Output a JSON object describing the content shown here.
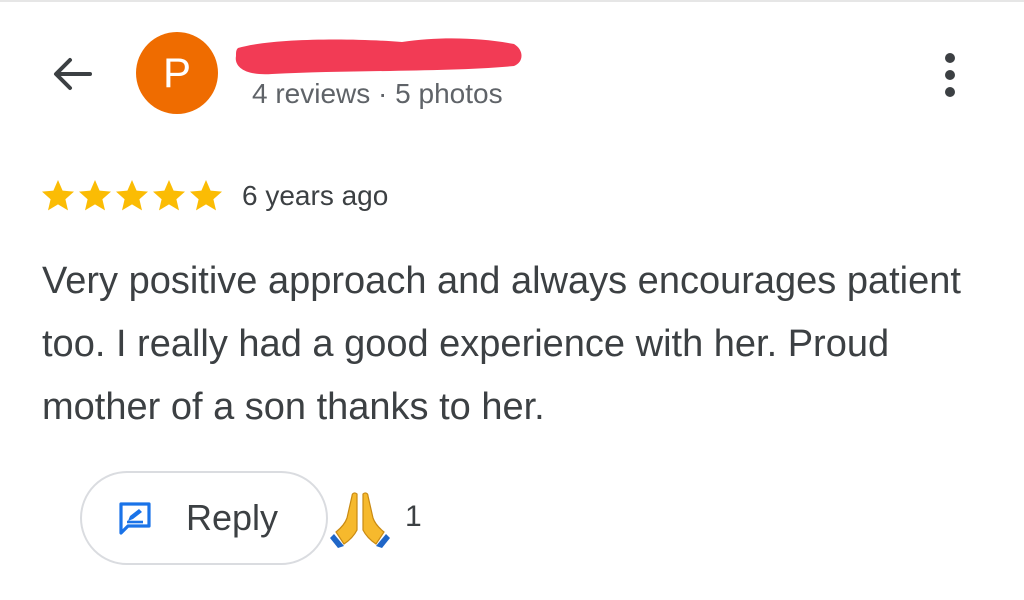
{
  "header": {
    "avatar_letter": "P",
    "avatar_color": "#ef6c00",
    "name_redaction_color": "#f23b55",
    "meta": "4 reviews · 5 photos",
    "back_icon": "arrow-left-icon",
    "more_icon": "more-vertical-icon"
  },
  "review": {
    "rating": 5,
    "rating_max": 5,
    "star_color": "#fbbc04",
    "time": "6 years ago",
    "text": "Very positive approach and always encourages patient too. I really had a good experience with her. Proud mother of a son thanks to her."
  },
  "actions": {
    "reply_label": "Reply",
    "reply_icon": "reply-icon",
    "reply_icon_color": "#1a73e8",
    "reaction_icon": "folded-hands-emoji",
    "reaction_count": "1"
  }
}
